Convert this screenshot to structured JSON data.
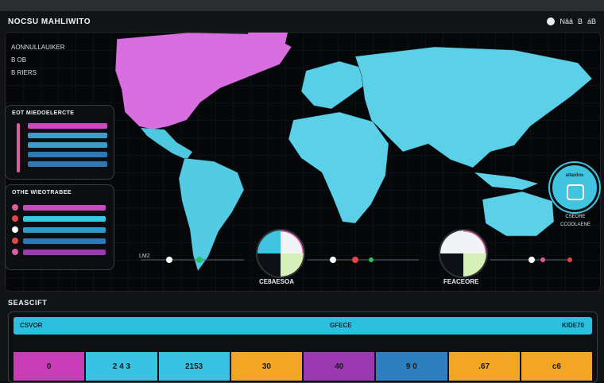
{
  "app": {
    "title": "NOCSU MAHLIWITO",
    "top_right": [
      "☻",
      "Nââ",
      "B",
      "áB"
    ]
  },
  "legend": {
    "heading": "AONNULLAUIKER",
    "items": [
      "B OB",
      "B RIERS"
    ]
  },
  "panel_top": {
    "title": "EOT MIEDOELERCTE"
  },
  "panel_bottom": {
    "title": "OTHE WIEOTRABEE"
  },
  "timeline": {
    "tick_label": "LM2"
  },
  "gauges": [
    {
      "label": "CE8AESOA"
    },
    {
      "label": "FEACEORE"
    }
  ],
  "badge": {
    "text": "aitaidos",
    "notes": [
      "CSEORE",
      "CCOOLAENE"
    ]
  },
  "section": {
    "title": "SEASCIFT"
  },
  "table": {
    "headers": [
      "CSVOR",
      "GFECE",
      "KIDE70"
    ],
    "cells": [
      "0",
      "2 4 3",
      "2153",
      "30",
      "40",
      "9 0",
      ".67",
      "c6"
    ],
    "colors": [
      "#c83cb6",
      "#37c3e1",
      "#37c3e1",
      "#f2a624",
      "#9a39b2",
      "#2f7fc0",
      "#f2a624",
      "#f2a624"
    ]
  },
  "colors": {
    "accent_cyan": "#41c4df",
    "accent_magenta": "#e05ca0",
    "accent_orange": "#f2a624"
  }
}
